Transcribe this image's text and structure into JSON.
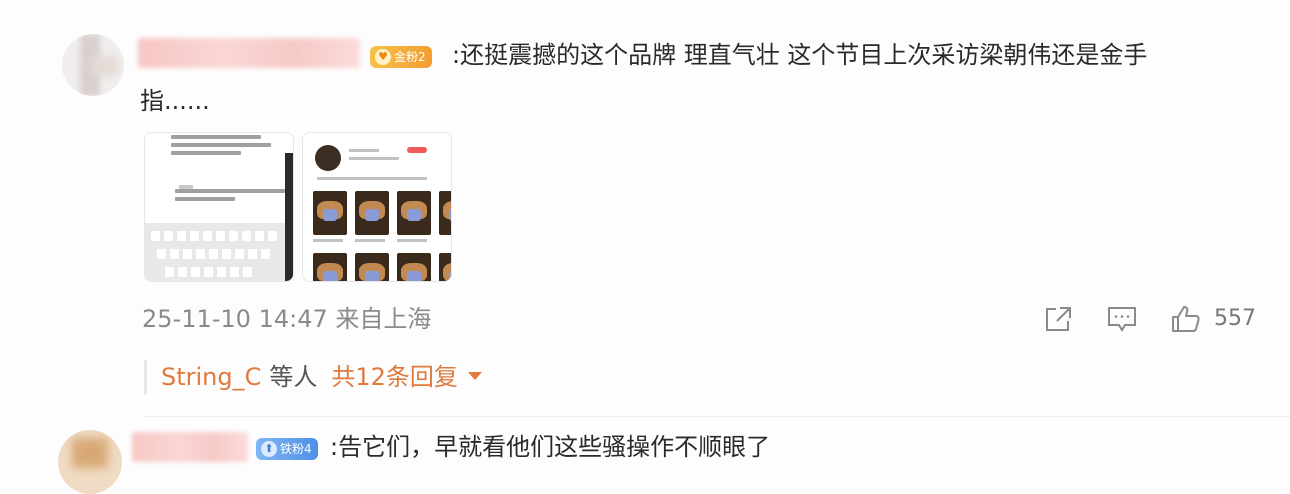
{
  "comment1": {
    "badge_label": "金粉2",
    "text_line1": ":还挺震撼的这个品牌 理直气壮 这个节目上次采访梁朝伟还是金手",
    "text_line2": "指......",
    "timestamp": "25-11-10 14:47",
    "location": "来自上海",
    "like_count": "557",
    "reply_user": "String_C",
    "reply_tail": "等人",
    "reply_count": "共12条回复"
  },
  "comment2": {
    "badge_label": "铁粉4",
    "text_line1": ":告它们，早就看他们这些骚操作不顺眼了"
  },
  "colors": {
    "link_orange": "#e07a3c",
    "meta_gray": "#8a8a8a",
    "badge_gold": "#f39c2f",
    "badge_blue": "#4f8fe6"
  },
  "icons": [
    "share-icon",
    "comment-icon",
    "like-icon",
    "expand-caret-icon"
  ]
}
